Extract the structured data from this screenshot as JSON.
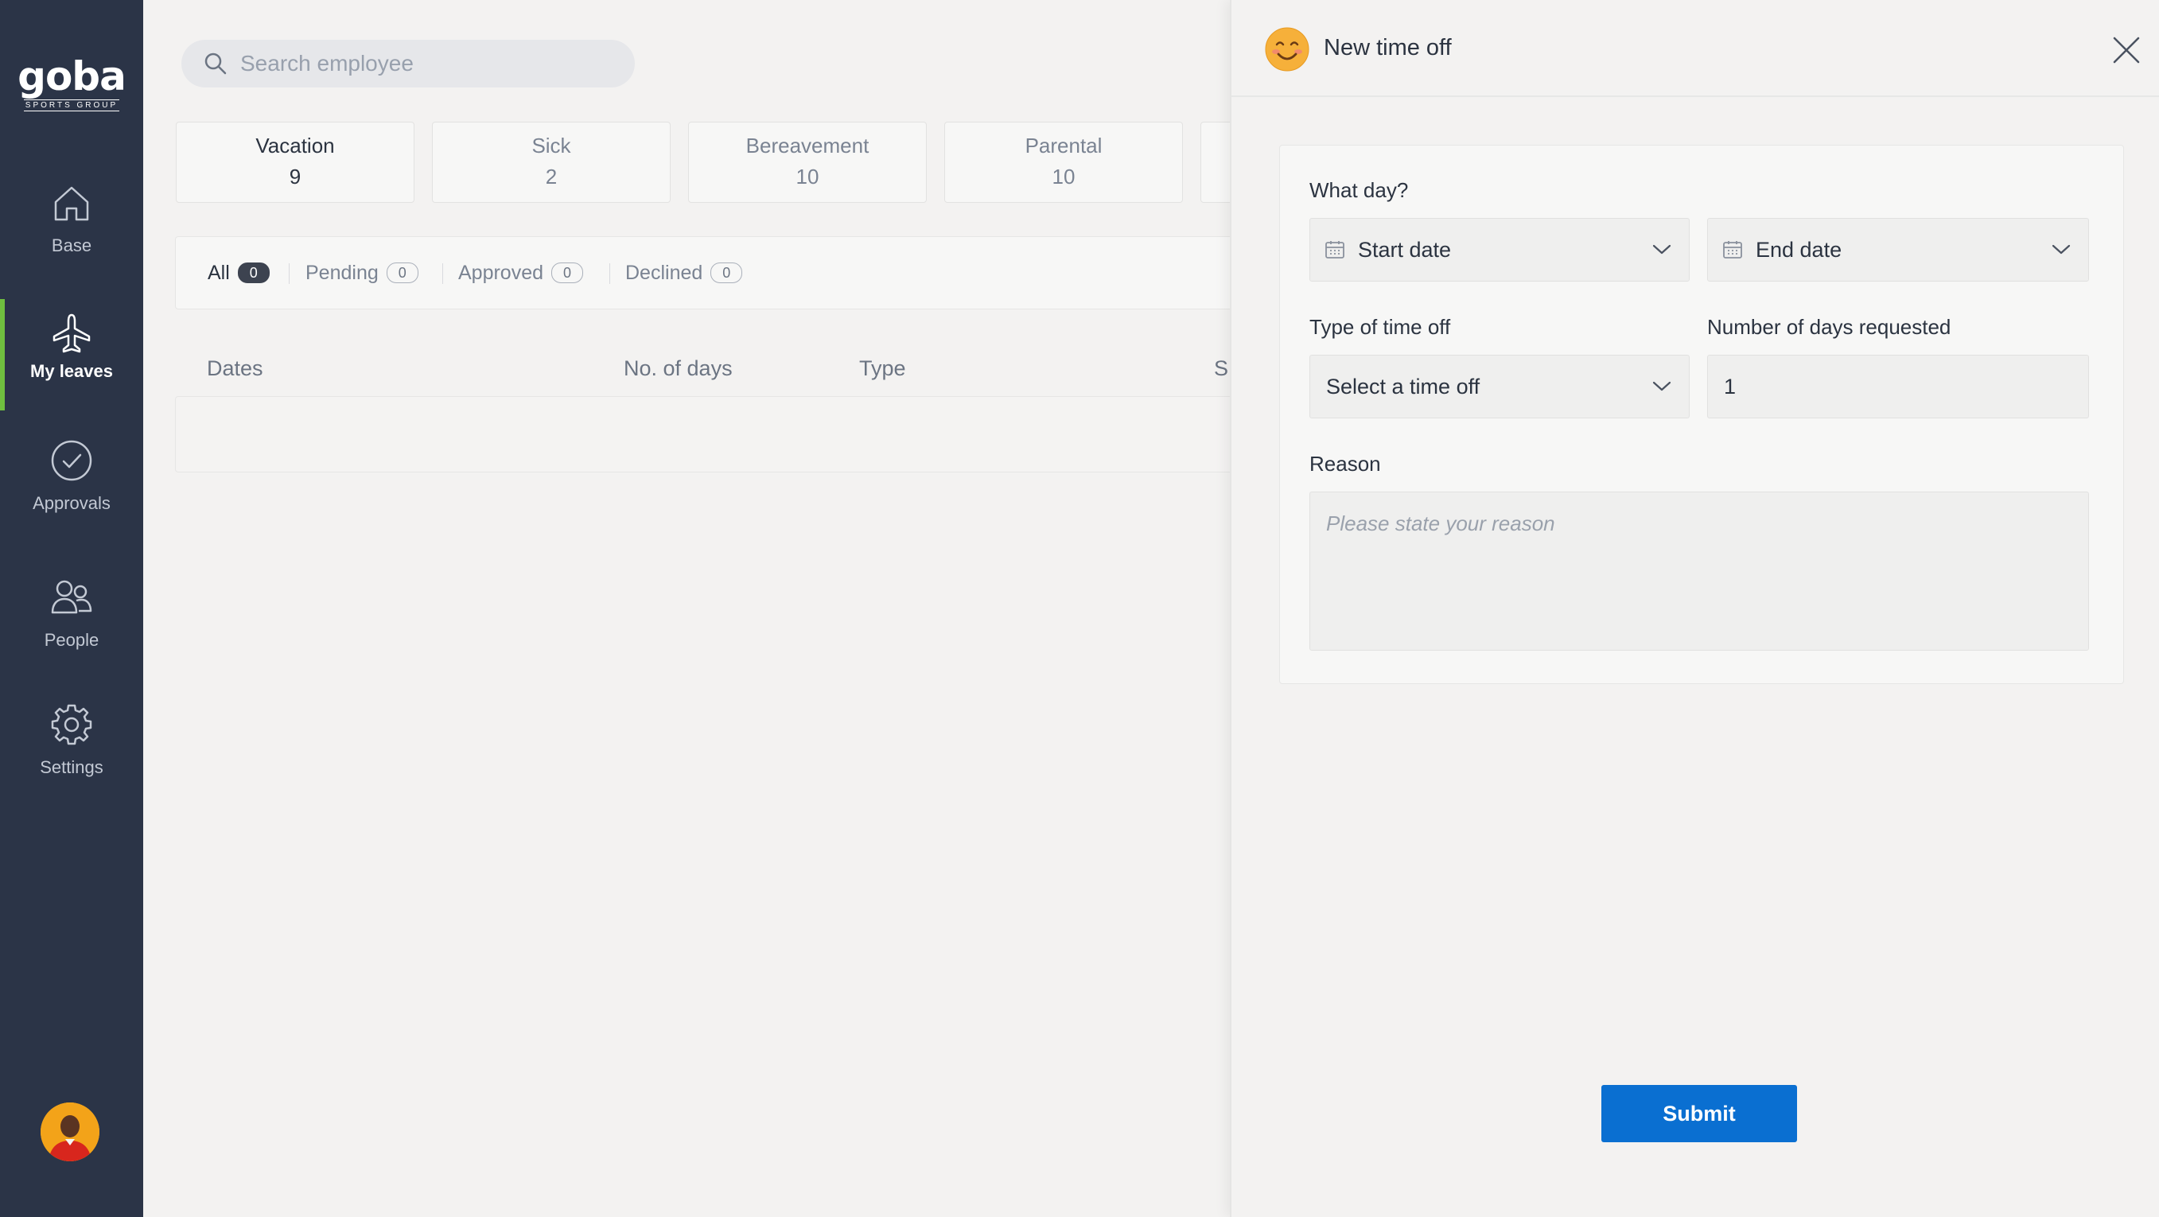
{
  "brand": {
    "name": "goba",
    "tagline": "SPORTS GROUP"
  },
  "sidebar": {
    "items": [
      {
        "label": "Base",
        "icon": "home-icon",
        "active": false
      },
      {
        "label": "My leaves",
        "icon": "airplane-icon",
        "active": true
      },
      {
        "label": "Approvals",
        "icon": "check-circle-icon",
        "active": false
      },
      {
        "label": "People",
        "icon": "people-icon",
        "active": false
      },
      {
        "label": "Settings",
        "icon": "gear-icon",
        "active": false
      }
    ],
    "avatar": "user-avatar"
  },
  "search": {
    "placeholder": "Search employee"
  },
  "balances": [
    {
      "name": "Vacation",
      "count": "9"
    },
    {
      "name": "Sick",
      "count": "2"
    },
    {
      "name": "Bereavement",
      "count": "10"
    },
    {
      "name": "Parental",
      "count": "10"
    }
  ],
  "filters": [
    {
      "label": "All",
      "count": "0",
      "active": true
    },
    {
      "label": "Pending",
      "count": "0",
      "active": false
    },
    {
      "label": "Approved",
      "count": "0",
      "active": false
    },
    {
      "label": "Declined",
      "count": "0",
      "active": false
    }
  ],
  "table": {
    "headers": [
      "Dates",
      "No. of days",
      "Type",
      "S"
    ]
  },
  "drawer": {
    "title": "New time off",
    "emoji": "smiling-face-icon",
    "what_day_label": "What day?",
    "start_date": "Start date",
    "end_date": "End date",
    "type_label": "Type of time off",
    "type_value": "Select a time off",
    "days_label": "Number of days requested",
    "days_value": "1",
    "reason_label": "Reason",
    "reason_placeholder": "Please state your reason",
    "submit_label": "Submit"
  },
  "colors": {
    "sidebar_bg": "#2b3447",
    "active_accent": "#6fbf3f",
    "primary_button": "#0a6fd1",
    "background": "#f3f2f1"
  }
}
